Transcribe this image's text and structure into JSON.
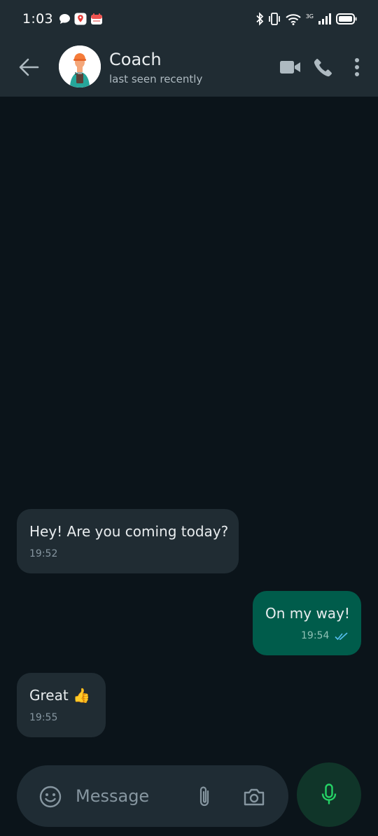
{
  "status_bar": {
    "time": "1:03",
    "notification_icons": [
      "chat-bubble-icon",
      "map-pin-icon",
      "calendar-icon"
    ],
    "network_label": "3G",
    "right_icons": [
      "bluetooth-icon",
      "vibrate-icon",
      "wifi-icon",
      "signal-icon",
      "battery-icon"
    ]
  },
  "header": {
    "contact_name": "Coach",
    "contact_status": "last seen recently",
    "actions": [
      "video-call-icon",
      "phone-icon",
      "more-vert-icon"
    ]
  },
  "messages": [
    {
      "direction": "incoming",
      "text": "Hey! Are you coming today?",
      "time": "19:52"
    },
    {
      "direction": "outgoing",
      "text": "On my way!",
      "time": "19:54",
      "status": "read"
    },
    {
      "direction": "incoming",
      "text": "Great 👍",
      "time": "19:55"
    }
  ],
  "composer": {
    "placeholder": "Message",
    "value": ""
  },
  "colors": {
    "background": "#0b141a",
    "header": "#202c33",
    "incoming_bubble": "#202c33",
    "outgoing_bubble": "#005c4b",
    "accent_green": "#25d366",
    "read_ticks": "#53bdeb"
  }
}
